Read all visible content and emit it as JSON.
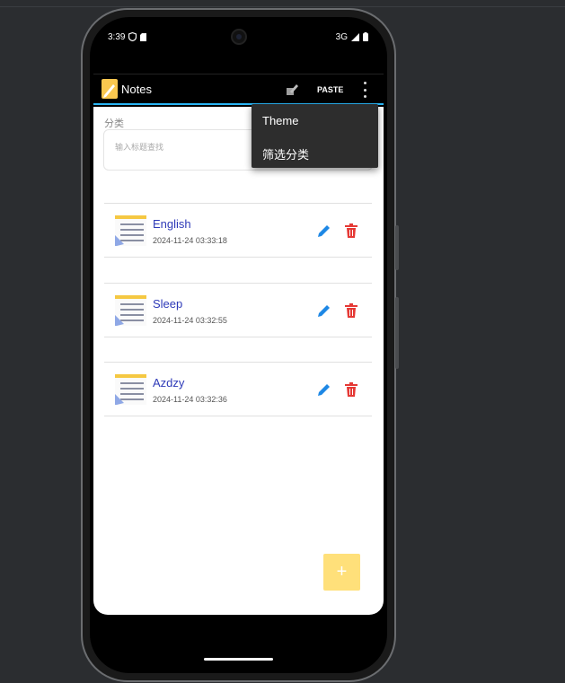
{
  "status_bar": {
    "time": "3:39",
    "network": "3G"
  },
  "appbar": {
    "title": "Notes",
    "paste_label": "PASTE"
  },
  "overflow_menu": {
    "items": [
      "Theme",
      "筛选分类"
    ]
  },
  "filter": {
    "category_label": "分类",
    "search_placeholder": "输入标题查找"
  },
  "notes": [
    {
      "title": "English",
      "date": "2024-11-24 03:33:18"
    },
    {
      "title": "Sleep",
      "date": "2024-11-24 03:32:55"
    },
    {
      "title": "Azdzy",
      "date": "2024-11-24 03:32:36"
    }
  ],
  "fab": {
    "label": "+"
  },
  "colors": {
    "accent": "#29b6f6",
    "note_title": "#2e3ab8",
    "edit": "#1e88e5",
    "delete": "#e53935",
    "fab": "#ffe07a",
    "logo": "#f9c74f"
  }
}
